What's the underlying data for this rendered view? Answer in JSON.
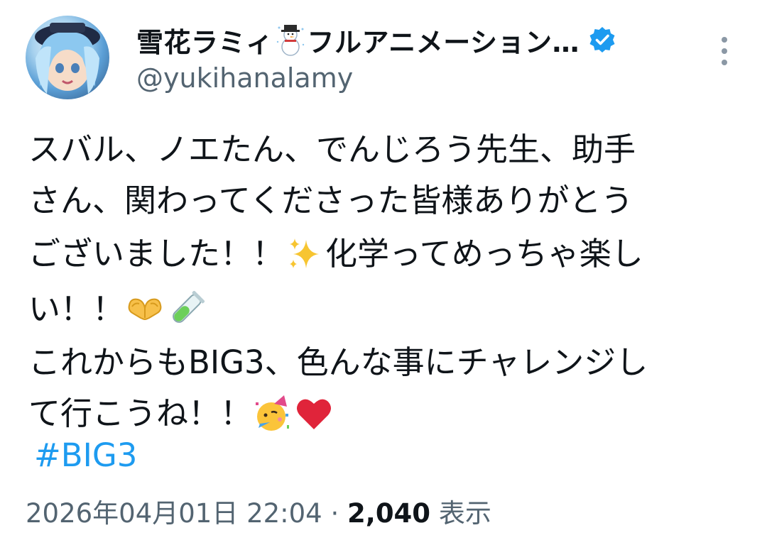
{
  "author": {
    "display_name": "雪花ラミィ",
    "name_suffix": "フルアニメーション…",
    "handle": "@yukihanalamy",
    "verified": true,
    "name_emoji": "snowman-icon"
  },
  "tweet": {
    "lines": [
      "スバル、ノエたん、でんじろう先生、助手",
      "さん、関わってくださった皆様ありがとう",
      "ございました！！",
      "化学ってめっちゃ楽し",
      "い！！",
      "これからもBIG3、色んな事にチャレンジし",
      "て行こうね！！"
    ],
    "emojis": [
      "sparkles-icon",
      "heart-hands-icon",
      "test-tube-icon",
      "partying-face-icon",
      "red-heart-icon"
    ],
    "hashtag": "#BIG3"
  },
  "meta": {
    "timestamp": "2026年04月01日 22:04",
    "separator": "·",
    "views_count": "2,040",
    "views_label": "表示"
  },
  "colors": {
    "text": "#0f1419",
    "secondary": "#536471",
    "link": "#1d9bf0",
    "verified": "#1d9bf0",
    "heart": "#e0243a"
  }
}
